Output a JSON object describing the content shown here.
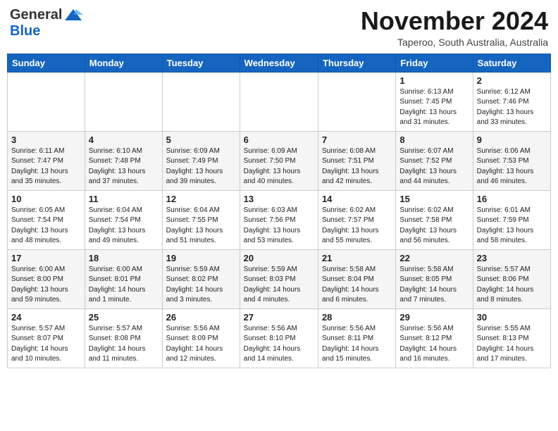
{
  "header": {
    "logo_line1": "General",
    "logo_line2": "Blue",
    "month_title": "November 2024",
    "location": "Taperoo, South Australia, Australia"
  },
  "days_of_week": [
    "Sunday",
    "Monday",
    "Tuesday",
    "Wednesday",
    "Thursday",
    "Friday",
    "Saturday"
  ],
  "weeks": [
    [
      {
        "day": "",
        "info": ""
      },
      {
        "day": "",
        "info": ""
      },
      {
        "day": "",
        "info": ""
      },
      {
        "day": "",
        "info": ""
      },
      {
        "day": "",
        "info": ""
      },
      {
        "day": "1",
        "info": "Sunrise: 6:13 AM\nSunset: 7:45 PM\nDaylight: 13 hours\nand 31 minutes."
      },
      {
        "day": "2",
        "info": "Sunrise: 6:12 AM\nSunset: 7:46 PM\nDaylight: 13 hours\nand 33 minutes."
      }
    ],
    [
      {
        "day": "3",
        "info": "Sunrise: 6:11 AM\nSunset: 7:47 PM\nDaylight: 13 hours\nand 35 minutes."
      },
      {
        "day": "4",
        "info": "Sunrise: 6:10 AM\nSunset: 7:48 PM\nDaylight: 13 hours\nand 37 minutes."
      },
      {
        "day": "5",
        "info": "Sunrise: 6:09 AM\nSunset: 7:49 PM\nDaylight: 13 hours\nand 39 minutes."
      },
      {
        "day": "6",
        "info": "Sunrise: 6:09 AM\nSunset: 7:50 PM\nDaylight: 13 hours\nand 40 minutes."
      },
      {
        "day": "7",
        "info": "Sunrise: 6:08 AM\nSunset: 7:51 PM\nDaylight: 13 hours\nand 42 minutes."
      },
      {
        "day": "8",
        "info": "Sunrise: 6:07 AM\nSunset: 7:52 PM\nDaylight: 13 hours\nand 44 minutes."
      },
      {
        "day": "9",
        "info": "Sunrise: 6:06 AM\nSunset: 7:53 PM\nDaylight: 13 hours\nand 46 minutes."
      }
    ],
    [
      {
        "day": "10",
        "info": "Sunrise: 6:05 AM\nSunset: 7:54 PM\nDaylight: 13 hours\nand 48 minutes."
      },
      {
        "day": "11",
        "info": "Sunrise: 6:04 AM\nSunset: 7:54 PM\nDaylight: 13 hours\nand 49 minutes."
      },
      {
        "day": "12",
        "info": "Sunrise: 6:04 AM\nSunset: 7:55 PM\nDaylight: 13 hours\nand 51 minutes."
      },
      {
        "day": "13",
        "info": "Sunrise: 6:03 AM\nSunset: 7:56 PM\nDaylight: 13 hours\nand 53 minutes."
      },
      {
        "day": "14",
        "info": "Sunrise: 6:02 AM\nSunset: 7:57 PM\nDaylight: 13 hours\nand 55 minutes."
      },
      {
        "day": "15",
        "info": "Sunrise: 6:02 AM\nSunset: 7:58 PM\nDaylight: 13 hours\nand 56 minutes."
      },
      {
        "day": "16",
        "info": "Sunrise: 6:01 AM\nSunset: 7:59 PM\nDaylight: 13 hours\nand 58 minutes."
      }
    ],
    [
      {
        "day": "17",
        "info": "Sunrise: 6:00 AM\nSunset: 8:00 PM\nDaylight: 13 hours\nand 59 minutes."
      },
      {
        "day": "18",
        "info": "Sunrise: 6:00 AM\nSunset: 8:01 PM\nDaylight: 14 hours\nand 1 minute."
      },
      {
        "day": "19",
        "info": "Sunrise: 5:59 AM\nSunset: 8:02 PM\nDaylight: 14 hours\nand 3 minutes."
      },
      {
        "day": "20",
        "info": "Sunrise: 5:59 AM\nSunset: 8:03 PM\nDaylight: 14 hours\nand 4 minutes."
      },
      {
        "day": "21",
        "info": "Sunrise: 5:58 AM\nSunset: 8:04 PM\nDaylight: 14 hours\nand 6 minutes."
      },
      {
        "day": "22",
        "info": "Sunrise: 5:58 AM\nSunset: 8:05 PM\nDaylight: 14 hours\nand 7 minutes."
      },
      {
        "day": "23",
        "info": "Sunrise: 5:57 AM\nSunset: 8:06 PM\nDaylight: 14 hours\nand 8 minutes."
      }
    ],
    [
      {
        "day": "24",
        "info": "Sunrise: 5:57 AM\nSunset: 8:07 PM\nDaylight: 14 hours\nand 10 minutes."
      },
      {
        "day": "25",
        "info": "Sunrise: 5:57 AM\nSunset: 8:08 PM\nDaylight: 14 hours\nand 11 minutes."
      },
      {
        "day": "26",
        "info": "Sunrise: 5:56 AM\nSunset: 8:09 PM\nDaylight: 14 hours\nand 12 minutes."
      },
      {
        "day": "27",
        "info": "Sunrise: 5:56 AM\nSunset: 8:10 PM\nDaylight: 14 hours\nand 14 minutes."
      },
      {
        "day": "28",
        "info": "Sunrise: 5:56 AM\nSunset: 8:11 PM\nDaylight: 14 hours\nand 15 minutes."
      },
      {
        "day": "29",
        "info": "Sunrise: 5:56 AM\nSunset: 8:12 PM\nDaylight: 14 hours\nand 16 minutes."
      },
      {
        "day": "30",
        "info": "Sunrise: 5:55 AM\nSunset: 8:13 PM\nDaylight: 14 hours\nand 17 minutes."
      }
    ]
  ]
}
